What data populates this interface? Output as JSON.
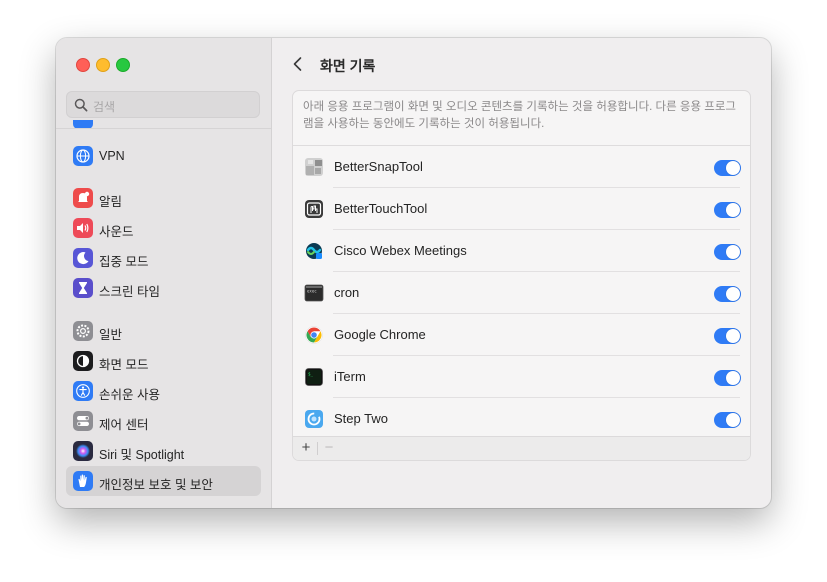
{
  "window": {
    "title": "화면 기록"
  },
  "search": {
    "placeholder": "검색"
  },
  "sidebar": {
    "items": [
      {
        "label": "VPN",
        "icon": "globe-icon",
        "color": "#2f7bf5"
      },
      {
        "label": "알림",
        "icon": "bell-icon",
        "color": "#ee4b4b"
      },
      {
        "label": "사운드",
        "icon": "speaker-icon",
        "color": "#ee4a58"
      },
      {
        "label": "집중 모드",
        "icon": "moon-icon",
        "color": "#5856d6"
      },
      {
        "label": "스크린 타임",
        "icon": "hourglass-icon",
        "color": "#5a4ecb"
      },
      {
        "label": "일반",
        "icon": "gear-icon",
        "color": "#8e8e93"
      },
      {
        "label": "화면 모드",
        "icon": "appearance-icon",
        "color": "#1c1c1e"
      },
      {
        "label": "손쉬운 사용",
        "icon": "accessibility-icon",
        "color": "#2f7bf5"
      },
      {
        "label": "제어 센터",
        "icon": "control-center-icon",
        "color": "#8e8e93"
      },
      {
        "label": "Siri 및 Spotlight",
        "icon": "siri-icon",
        "color": "#3a3a5a"
      },
      {
        "label": "개인정보 보호 및 보안",
        "icon": "hand-icon",
        "color": "#2f7bf5"
      }
    ]
  },
  "main": {
    "description": "아래 응용 프로그램이 화면 및 오디오 콘텐츠를 기록하는 것을 허용합니다. 다른 응용 프로그램을 사용하는 동안에도 기록하는 것이 허용됩니다.",
    "apps": [
      {
        "name": "BetterSnapTool",
        "icon": "bettersnaptool-icon",
        "enabled": true
      },
      {
        "name": "BetterTouchTool",
        "icon": "bettertouchtool-icon",
        "enabled": true
      },
      {
        "name": "Cisco Webex Meetings",
        "icon": "webex-icon",
        "enabled": true
      },
      {
        "name": "cron",
        "icon": "terminal-icon",
        "enabled": true
      },
      {
        "name": "Google Chrome",
        "icon": "chrome-icon",
        "enabled": true
      },
      {
        "name": "iTerm",
        "icon": "iterm-icon",
        "enabled": true
      },
      {
        "name": "Step Two",
        "icon": "steptwo-icon",
        "enabled": true
      }
    ],
    "add_label": "+",
    "remove_label": "−"
  },
  "colors": {
    "accent": "#2f7bf5"
  }
}
